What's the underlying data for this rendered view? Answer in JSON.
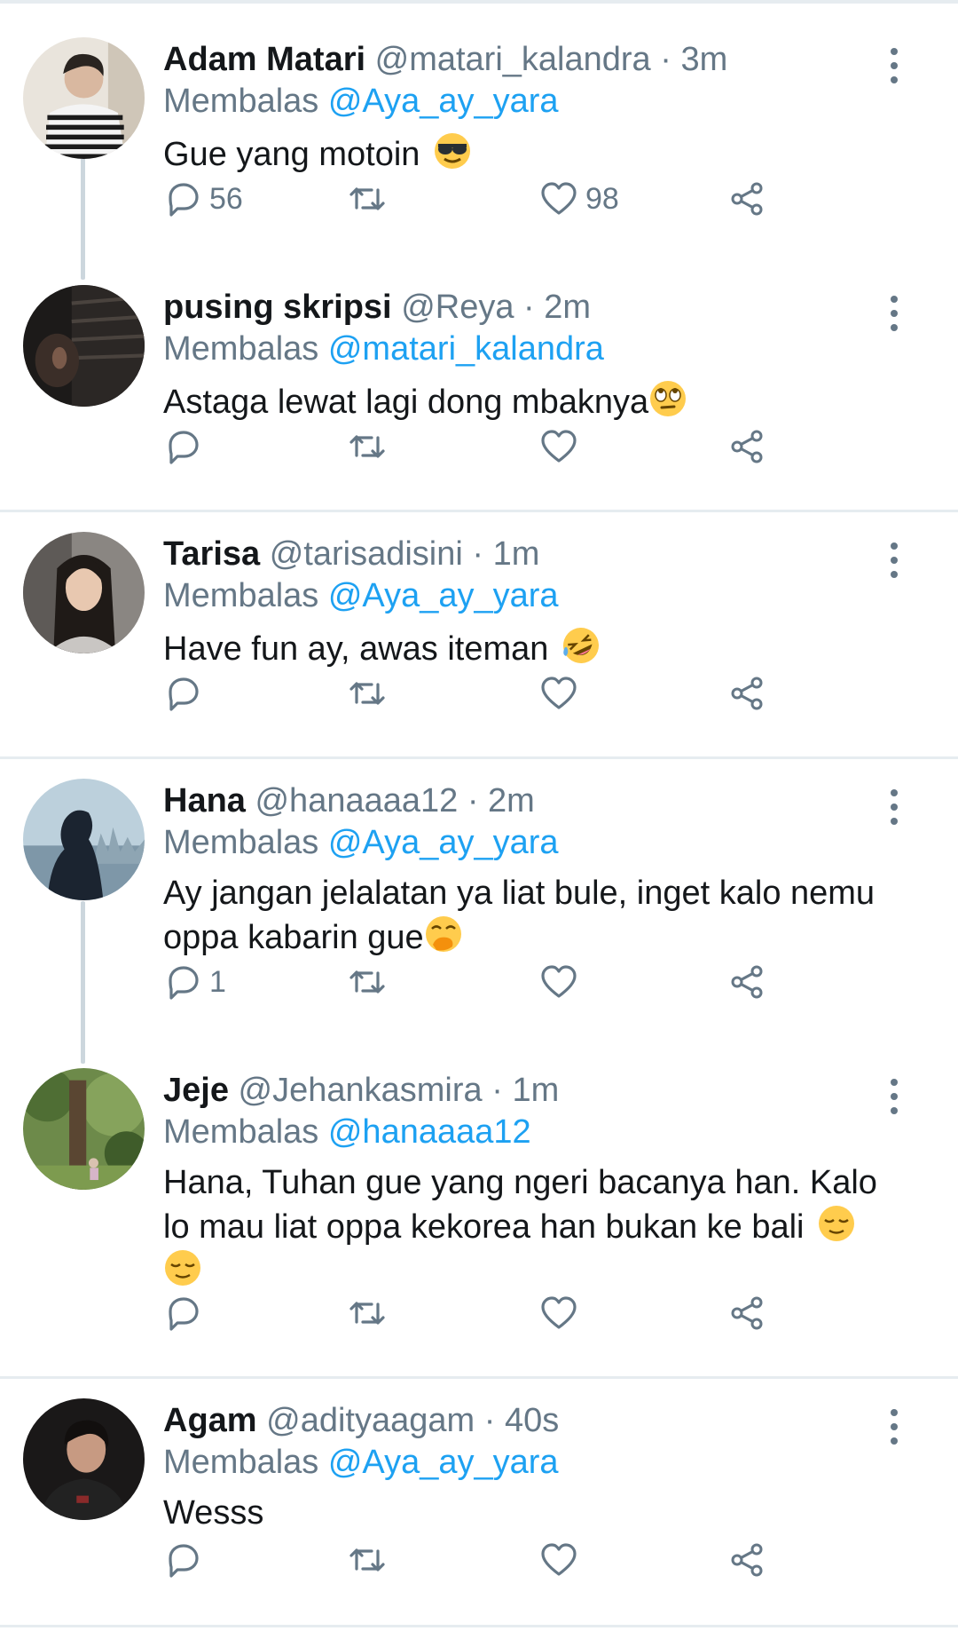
{
  "tweets": [
    {
      "name": "Adam Matari",
      "handle": "@matari_kalandra",
      "sep": "·",
      "time": "3m",
      "reply_prefix": "Membalas",
      "reply_to": "@Aya_ay_yara",
      "text": "Gue yang motoin",
      "emoji": "sunglasses-face",
      "reply_count": "56",
      "like_count": "98"
    },
    {
      "name": "pusing skripsi",
      "handle": "@Reya",
      "sep": "·",
      "time": "2m",
      "reply_prefix": "Membalas",
      "reply_to": "@matari_kalandra",
      "text": "Astaga lewat lagi dong mbaknya",
      "emoji": "eye-roll-face",
      "reply_count": "",
      "like_count": ""
    },
    {
      "name": "Tarisa",
      "handle": "@tarisadisini",
      "sep": "·",
      "time": "1m",
      "reply_prefix": "Membalas",
      "reply_to": "@Aya_ay_yara",
      "text": "Have fun ay, awas iteman",
      "emoji": "rofl-face",
      "reply_count": "",
      "like_count": ""
    },
    {
      "name": "Hana",
      "handle": "@hanaaaa12",
      "sep": "·",
      "time": "2m",
      "reply_prefix": "Membalas",
      "reply_to": "@Aya_ay_yara",
      "text": "Ay jangan jelalatan ya liat bule, inget kalo nemu oppa kabarin gue",
      "emoji": "hand-over-mouth-face",
      "reply_count": "1",
      "like_count": ""
    },
    {
      "name": "Jeje",
      "handle": "@Jehankasmira",
      "sep": "·",
      "time": "1m",
      "reply_prefix": "Membalas",
      "reply_to": "@hanaaaa12",
      "text": "Hana, Tuhan gue yang ngeri bacanya han. Kalo lo mau liat oppa kekorea han bukan ke bali",
      "emoji": "relieved-face",
      "reply_count": "",
      "like_count": ""
    },
    {
      "name": "Agam",
      "handle": "@adityaagam",
      "sep": "·",
      "time": "40s",
      "reply_prefix": "Membalas",
      "reply_to": "@Aya_ay_yara",
      "text": "Wesss",
      "emoji": "",
      "reply_count": "",
      "like_count": ""
    }
  ],
  "colors": {
    "mention": "#1da1f2",
    "secondary": "#657786",
    "separator": "#e6ecf0"
  }
}
